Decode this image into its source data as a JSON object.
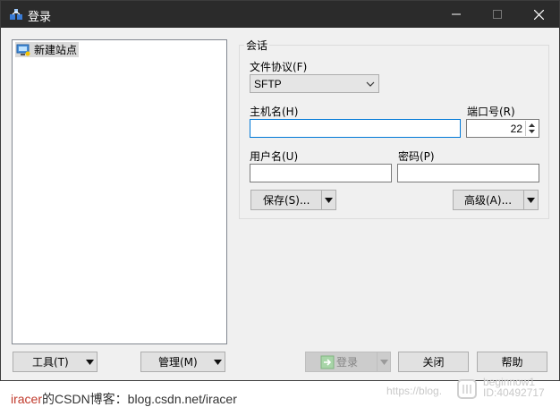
{
  "window": {
    "title": "登录"
  },
  "site_tree": {
    "items": [
      {
        "label": "新建站点"
      }
    ]
  },
  "session": {
    "group_label": "会话",
    "protocol_label": "文件协议(F)",
    "protocol_value": "SFTP",
    "host_label": "主机名(H)",
    "host_value": "",
    "port_label": "端口号(R)",
    "port_value": "22",
    "user_label": "用户名(U)",
    "user_value": "",
    "password_label": "密码(P)",
    "password_value": "",
    "save_label": "保存(S)...",
    "advanced_label": "高级(A)..."
  },
  "footer": {
    "tools_label": "工具(T)",
    "manage_label": "管理(M)",
    "login_label": "登录",
    "close_label": "关闭",
    "help_label": "帮助"
  },
  "watermark": {
    "author": "iracer",
    "text": "的CSDN博客：blog.csdn.net/iracer",
    "corner_text_1": "https://blog.",
    "corner_text_2": "beginnow1",
    "corner_text_3": "ID:40492717"
  },
  "colors": {
    "titlebar": "#2b2b2b",
    "focus_border": "#0078d7",
    "dialog_bg": "#f0f0f0",
    "author_red": "#c0392b"
  }
}
